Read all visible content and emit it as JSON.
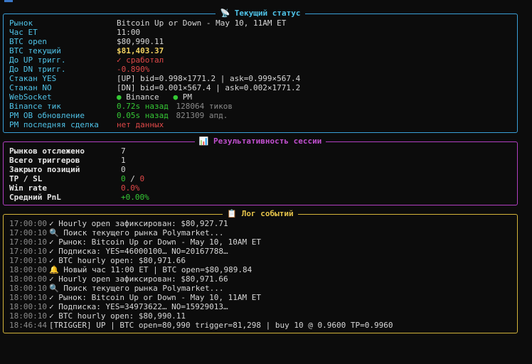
{
  "status": {
    "title": "📡 Текущий статус",
    "rows": [
      {
        "label": "Рынок",
        "value": "Bitcoin Up or Down - May 10, 11AM ET"
      },
      {
        "label": "Час ET",
        "value": "11:00"
      },
      {
        "label": "BTC open",
        "value": "$80,990.11"
      },
      {
        "label": "BTC текущий",
        "value": "$81,403.37"
      },
      {
        "label": "До UP тригг.",
        "value": "✓ сработал"
      },
      {
        "label": "До DN тригг.",
        "value": "-0.890%"
      },
      {
        "label": "Стакан YES",
        "value": "[UP] bid=0.998×1771.2 | ask=0.999×567.4"
      },
      {
        "label": "Стакан NO",
        "value": "[DN] bid=0.001×567.4 | ask=0.002×1771.2"
      },
      {
        "label": "WebSocket",
        "binance": "Binance",
        "pm": "PM",
        "dot": "●"
      },
      {
        "label": "Binance тик",
        "ago": "0.72s назад",
        "extra": "128064 тиков"
      },
      {
        "label": "PM OB обновление",
        "ago": "0.05s назад",
        "extra": "821309 апд."
      },
      {
        "label": "PM последняя сделка",
        "value": "нет данных"
      }
    ]
  },
  "perf": {
    "title": "📊 Результативность сессии",
    "rows": [
      {
        "label": "Рынков отслежено",
        "value": "7"
      },
      {
        "label": "Всего триггеров",
        "value": "1"
      },
      {
        "label": "Закрыто позиций",
        "value": "0"
      },
      {
        "label": "TP / SL",
        "tp": "0",
        "sep": " / ",
        "sl": "0"
      },
      {
        "label": "Win rate",
        "value": "0.0%"
      },
      {
        "label": "Средний PnL",
        "value": "+0.00%"
      }
    ]
  },
  "log": {
    "title": "📋 Лог событий",
    "entries": [
      {
        "ts": "17:00:00",
        "msg": "✓ Hourly open зафиксирован: $80,927.71"
      },
      {
        "ts": "17:00:10",
        "msg": "🔍 Поиск текущего рынка Polymarket..."
      },
      {
        "ts": "17:00:10",
        "msg": "✓ Рынок: Bitcoin Up or Down - May 10, 10AM ET"
      },
      {
        "ts": "17:00:10",
        "msg": "✓ Подписка: YES=46000100… NO=20167788…"
      },
      {
        "ts": "17:00:10",
        "msg": "✓ BTC hourly open: $80,971.66"
      },
      {
        "ts": "18:00:00",
        "msg": "🔔 Новый час 11:00 ET | BTC open=$80,989.84"
      },
      {
        "ts": "18:00:00",
        "msg": "✓ Hourly open зафиксирован: $80,971.66"
      },
      {
        "ts": "18:00:10",
        "msg": "🔍 Поиск текущего рынка Polymarket..."
      },
      {
        "ts": "18:00:10",
        "msg": "✓ Рынок: Bitcoin Up or Down - May 10, 11AM ET"
      },
      {
        "ts": "18:00:10",
        "msg": "✓ Подписка: YES=34973622… NO=15929013…"
      },
      {
        "ts": "18:00:10",
        "msg": "✓ BTC hourly open: $80,990.11"
      },
      {
        "ts": "18:46:44",
        "msg": "[TRIGGER] UP | BTC open=80,990 trigger=81,298 | buy 10 @ 0.9600 TP=0.9960"
      }
    ]
  },
  "colors": {
    "status_border": "#3aa0d8",
    "perf_border": "#b23fc2",
    "log_border": "#d4b43a",
    "positive": "#35c935",
    "negative": "#e04848",
    "highlight": "#f0d060"
  }
}
